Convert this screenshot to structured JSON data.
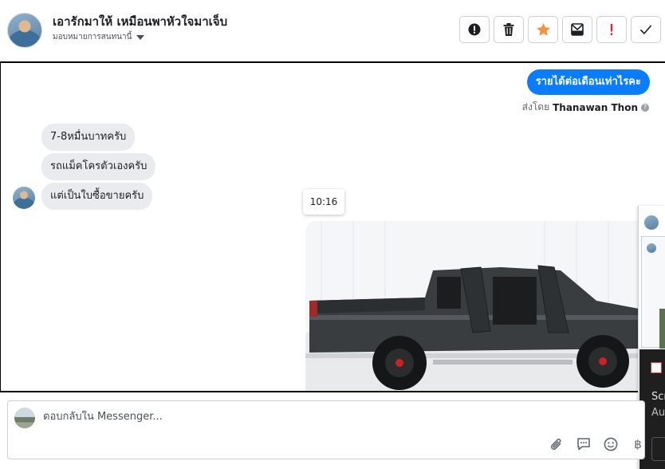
{
  "header": {
    "contact_name": "เอารักมาให้ เหมือนพาหัวใจมาเจ็บ",
    "assign_label": "มอบหมายการสนทนานี้"
  },
  "toolbar": {
    "buttons": [
      "exclamation-circle-icon",
      "trash-icon",
      "star-icon",
      "mail-icon",
      "spam-exclamation-icon",
      "check-icon"
    ],
    "accent_star": "#f7923b",
    "accent_spam": "#e41e3f"
  },
  "thread": {
    "outgoing": {
      "text": "รายได้ต่อเดือนเท่าไรคะ",
      "sent_by_prefix": "ส่งโดย",
      "sent_by_name": "Thanawan Thon",
      "color": "#0a7cff"
    },
    "incoming": [
      {
        "text": "7-8หมื่นบาทครับ"
      },
      {
        "text": "รถแม็คโครตัวเองครับ"
      },
      {
        "text": "แต่เป็นใบซื้อขายครับ"
      }
    ],
    "time_chip": "10:16"
  },
  "side_panel": {
    "line1": "Scr",
    "line2": "Au"
  },
  "composer": {
    "placeholder": "ตอบกลับใน Messenger..."
  }
}
